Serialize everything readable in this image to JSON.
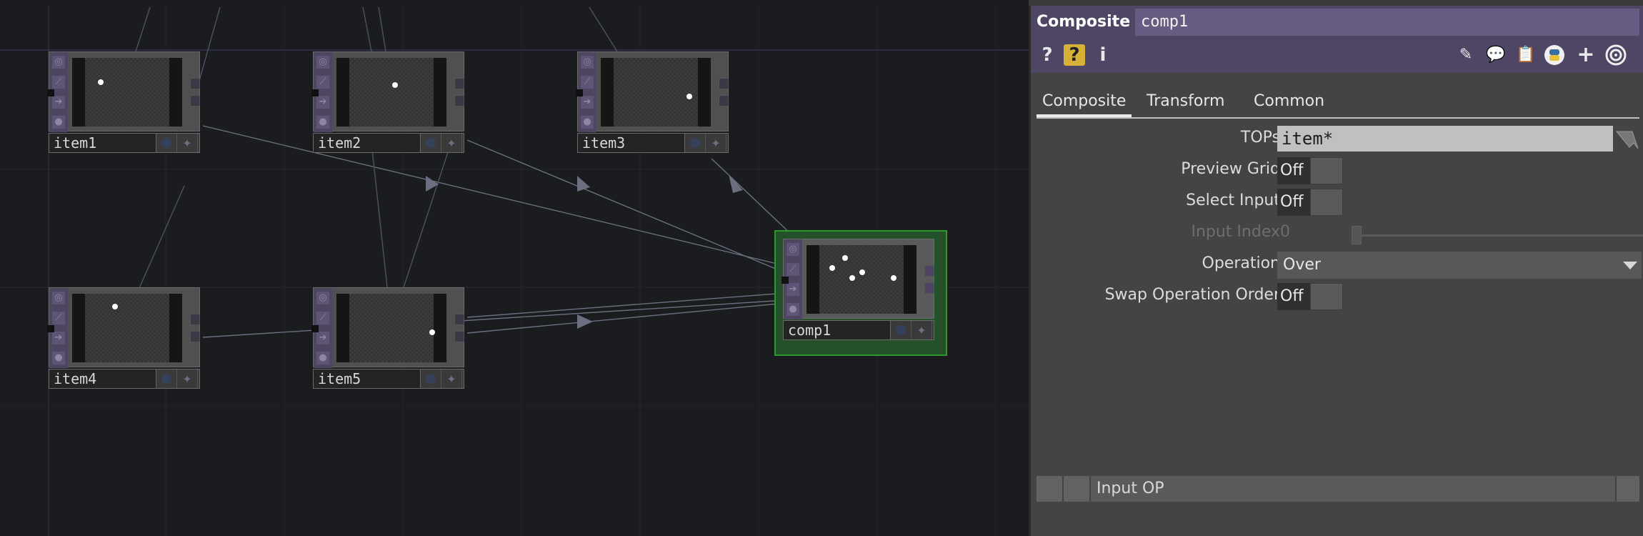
{
  "nodes": [
    {
      "name": "item1"
    },
    {
      "name": "item2"
    },
    {
      "name": "item3"
    },
    {
      "name": "item4"
    },
    {
      "name": "item5"
    },
    {
      "name": "comp1"
    }
  ],
  "icons": {
    "help": "?",
    "help_python": "?",
    "info": "i",
    "edit": "pencil-icon",
    "comment": "speech-bubble-icon",
    "clipboard": "clipboard-icon",
    "python": "python-icon",
    "add": "+",
    "target": "target-icon"
  },
  "panel": {
    "op_type": "Composite",
    "op_name": "comp1",
    "tabs": [
      "Composite",
      "Transform",
      "Common"
    ],
    "params": {
      "tops": {
        "label": "TOPs",
        "value": "item*"
      },
      "preview_grid": {
        "label": "Preview Grid",
        "value": "Off"
      },
      "select_input": {
        "label": "Select Input",
        "value": "Off"
      },
      "input_index": {
        "label": "Input Index",
        "value": "0"
      },
      "operation": {
        "label": "Operation",
        "value": "Over"
      },
      "swap_order": {
        "label": "Swap Operation Order",
        "value": "Off"
      }
    },
    "bottom_label": "Input OP"
  },
  "colors": {
    "selected_frame": "#2f9a2c",
    "panel_header": "#4e4664",
    "canvas": "#1b1c20"
  }
}
